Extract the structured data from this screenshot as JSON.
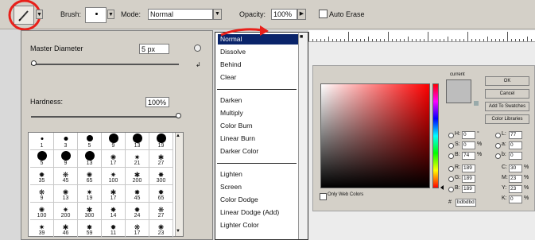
{
  "toolbar": {
    "brush_label": "Brush:",
    "mode_label": "Mode:",
    "mode_value": "Normal",
    "opacity_label": "Opacity:",
    "opacity_value": "100%",
    "airbrush_label": "Auto Erase",
    "tool_icon": "pencil-icon",
    "annotation_color": "#e8201a"
  },
  "brush_panel": {
    "diameter_label": "Master Diameter",
    "diameter_value": "5 px",
    "hardness_label": "Hardness:",
    "hardness_value": "100%",
    "brush_sizes": [
      [
        "1",
        "3",
        "5",
        "9",
        "13",
        "19"
      ],
      [
        "5",
        "9",
        "13",
        "17",
        "21",
        "27"
      ],
      [
        "35",
        "45",
        "65",
        "100",
        "200",
        "300"
      ],
      [
        "9",
        "13",
        "19",
        "17",
        "45",
        "65"
      ],
      [
        "100",
        "200",
        "300",
        "14",
        "24",
        "27"
      ],
      [
        "39",
        "46",
        "59",
        "11",
        "17",
        "23"
      ]
    ]
  },
  "blend_menu": {
    "groups": [
      [
        "Normal",
        "Dissolve",
        "Behind",
        "Clear"
      ],
      [
        "Darken",
        "Multiply",
        "Color Burn",
        "Linear Burn",
        "Darker Color"
      ],
      [
        "Lighten",
        "Screen",
        "Color Dodge",
        "Linear Dodge (Add)",
        "Lighter Color"
      ]
    ],
    "selected": "Normal"
  },
  "color_picker": {
    "ok_label": "OK",
    "cancel_label": "Cancel",
    "add_swatches_label": "Add To Swatches",
    "libraries_label": "Color Libraries",
    "current_label": "current",
    "only_web_label": "Only Web Colors",
    "hsb_fields": [
      {
        "label": "H:",
        "value": "0",
        "unit": "°"
      },
      {
        "label": "S:",
        "value": "0",
        "unit": "%"
      },
      {
        "label": "B:",
        "value": "74",
        "unit": "%"
      }
    ],
    "rgb_fields": [
      {
        "label": "R:",
        "value": "189"
      },
      {
        "label": "G:",
        "value": "189"
      },
      {
        "label": "B:",
        "value": "189"
      }
    ],
    "lab_fields": [
      {
        "label": "L:",
        "value": "77"
      },
      {
        "label": "a:",
        "value": "0"
      },
      {
        "label": "b:",
        "value": "0"
      }
    ],
    "cmyk_fields": [
      {
        "label": "C:",
        "value": "30",
        "unit": "%"
      },
      {
        "label": "M:",
        "value": "23",
        "unit": "%"
      },
      {
        "label": "Y:",
        "value": "23",
        "unit": "%"
      },
      {
        "label": "K:",
        "value": "0",
        "unit": "%"
      }
    ],
    "hex_label": "#",
    "hex_value": "bdbdbd"
  }
}
